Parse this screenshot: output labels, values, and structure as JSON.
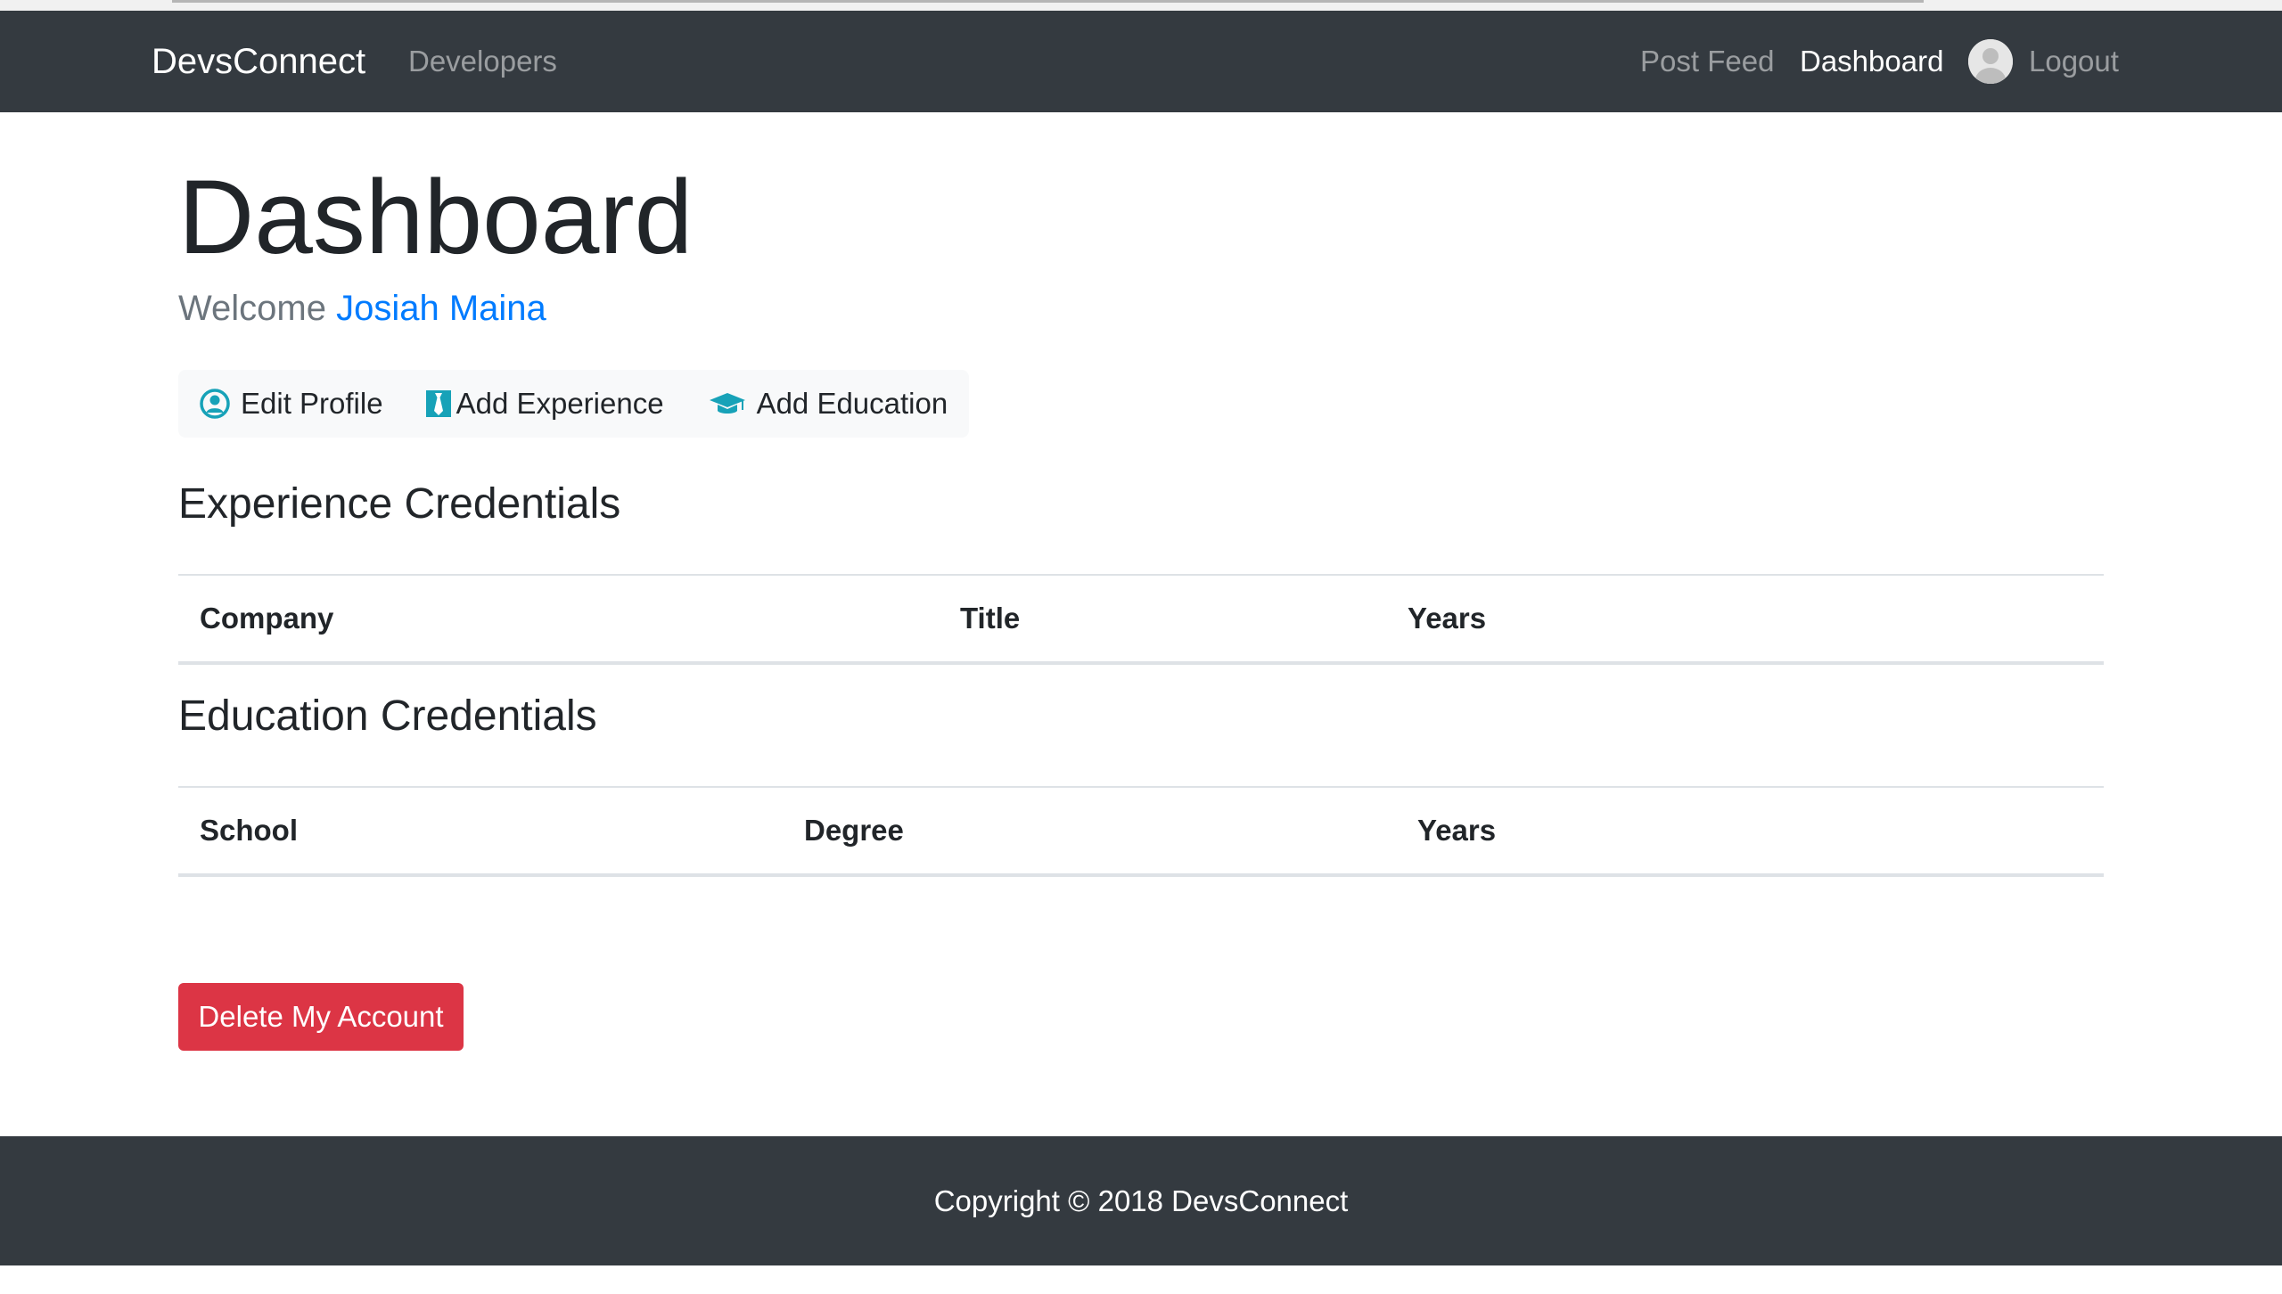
{
  "navbar": {
    "brand": "DevsConnect",
    "left_links": [
      {
        "label": "Developers"
      }
    ],
    "right_links": [
      {
        "label": "Post Feed",
        "active": false
      },
      {
        "label": "Dashboard",
        "active": true
      }
    ],
    "avatar_icon": "user-avatar-icon",
    "logout_label": "Logout"
  },
  "page": {
    "title": "Dashboard",
    "welcome_prefix": "Welcome",
    "user_name": "Josiah Maina"
  },
  "actions": [
    {
      "label": "Edit Profile",
      "icon": "user-circle-icon"
    },
    {
      "label": "Add Experience",
      "icon": "black-tie-icon"
    },
    {
      "label": "Add Education",
      "icon": "graduation-cap-icon"
    }
  ],
  "experience": {
    "heading": "Experience Credentials",
    "columns": [
      "Company",
      "Title",
      "Years"
    ]
  },
  "education": {
    "heading": "Education Credentials",
    "columns": [
      "School",
      "Degree",
      "Years"
    ]
  },
  "delete_button": "Delete My Account",
  "footer": {
    "text": "Copyright © 2018 DevsConnect"
  },
  "colors": {
    "navbar_bg": "#343a40",
    "link_primary": "#007bff",
    "icon_info": "#17a2b8",
    "danger": "#dc3545",
    "light_bg": "#f8f9fa"
  }
}
